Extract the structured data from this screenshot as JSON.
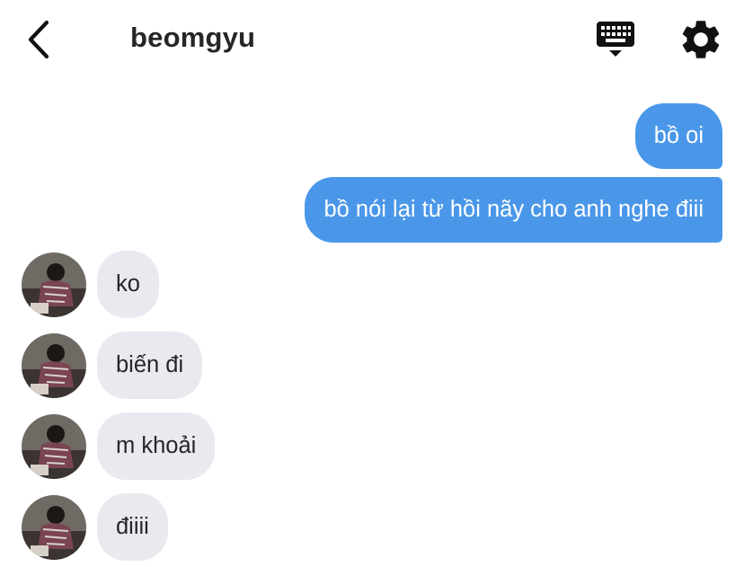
{
  "header": {
    "title": "beomgyu",
    "back_icon": "chevron-left-icon",
    "keyboard_icon": "keyboard-icon",
    "settings_icon": "gear-icon"
  },
  "colors": {
    "outgoing_bubble": "#4a97e9",
    "incoming_bubble": "#e8eaef",
    "text_dark": "#262626"
  },
  "messages": {
    "outgoing": [
      {
        "text": "bồ oi"
      },
      {
        "text": "bồ nói lại từ hồi nãy cho anh nghe điii"
      }
    ],
    "incoming": [
      {
        "text": "ko"
      },
      {
        "text": "biến đi"
      },
      {
        "text": "m khoải"
      },
      {
        "text": "điiii"
      }
    ]
  }
}
